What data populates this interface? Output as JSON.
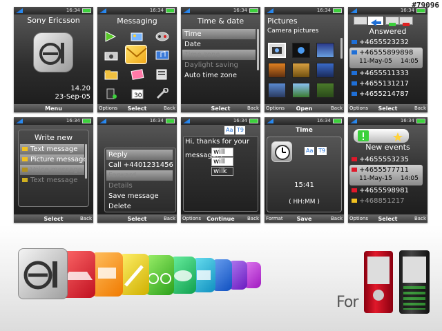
{
  "watermark": "#79096",
  "status_time": "16:34",
  "phones": {
    "home": {
      "title": "Sony Ericsson",
      "clock": "14.20",
      "date": "23-Sep-05",
      "center_key": "Menu"
    },
    "messaging": {
      "title": "Messaging",
      "left_key": "Options",
      "center_key": "Select",
      "right_key": "Back"
    },
    "time_date": {
      "title": "Time & date",
      "items": [
        {
          "label": "Time",
          "state": "selected"
        },
        {
          "label": "Date",
          "state": "normal"
        },
        {
          "label": "Time zone",
          "state": "selected-dim"
        },
        {
          "label": "Daylight saving",
          "state": "dim"
        },
        {
          "label": "Auto time zone",
          "state": "normal"
        }
      ],
      "center_key": "Select",
      "right_key": "Back"
    },
    "pictures": {
      "title": "Pictures",
      "subtitle": "Camera pictures",
      "left_key": "Options",
      "center_key": "Open",
      "right_key": "Back"
    },
    "answered": {
      "title": "Answered",
      "items": [
        {
          "number": "+4655523232",
          "expanded": false
        },
        {
          "number": "+46555899898",
          "expanded": true,
          "date": "11-May-05",
          "time": "14:05"
        },
        {
          "number": "+4655511333",
          "expanded": false
        },
        {
          "number": "+4655131217",
          "expanded": false
        },
        {
          "number": "+4655214787",
          "expanded": false
        }
      ],
      "left_key": "Options",
      "center_key": "Select",
      "right_key": "Back"
    },
    "write_new": {
      "title": "Write new",
      "items": [
        {
          "label": "Text message",
          "state": "selected"
        },
        {
          "label": "Picture message",
          "state": "selected"
        },
        {
          "label": "Voice message",
          "state": "selected-dim"
        },
        {
          "label": "Text message",
          "state": "dim"
        }
      ],
      "center_key": "Select",
      "right_key": "Back"
    },
    "options_menu": {
      "items": [
        {
          "label": "Reply",
          "state": "selected"
        },
        {
          "label": "Call +4401231456",
          "state": "normal"
        },
        {
          "label": "Forward",
          "state": "selected-dim"
        },
        {
          "label": "Details",
          "state": "dim"
        },
        {
          "label": "Save message",
          "state": "normal"
        },
        {
          "label": "Delete",
          "state": "normal"
        }
      ],
      "center_key": "Select",
      "right_key": "Back"
    },
    "compose": {
      "mode_a": "Aa",
      "mode_b": "T9",
      "text_line1": "Hi, thanks for your",
      "text_line2": "message. I",
      "suggestions": [
        "will",
        "will",
        "wilk"
      ],
      "left_key": "Options",
      "center_key": "Continue",
      "right_key": "Back"
    },
    "time_set": {
      "title": "Time",
      "mode_a": "Aa",
      "mode_b": "T9",
      "time_value": "15:41",
      "format": "( HH:MM )",
      "left_key": "Format",
      "center_key": "Save",
      "right_key": "Back"
    },
    "new_events": {
      "title": "New events",
      "items": [
        {
          "label": "+4655553235",
          "expanded": false
        },
        {
          "label": "+4655577711",
          "expanded": true,
          "date": "11-May-15",
          "time": "14:05"
        },
        {
          "label": "+4655598981",
          "expanded": false
        },
        {
          "label": "+468851217",
          "expanded": false
        }
      ],
      "left_key": "Options",
      "center_key": "Select",
      "right_key": "Back"
    }
  },
  "footer_text": "For",
  "colors": {
    "accent_red": "#e0182a",
    "accent_orange": "#ff8c1a",
    "accent_green": "#5ad12a",
    "accent_blue": "#2a8bf0",
    "accent_purple": "#9a4ee0"
  }
}
